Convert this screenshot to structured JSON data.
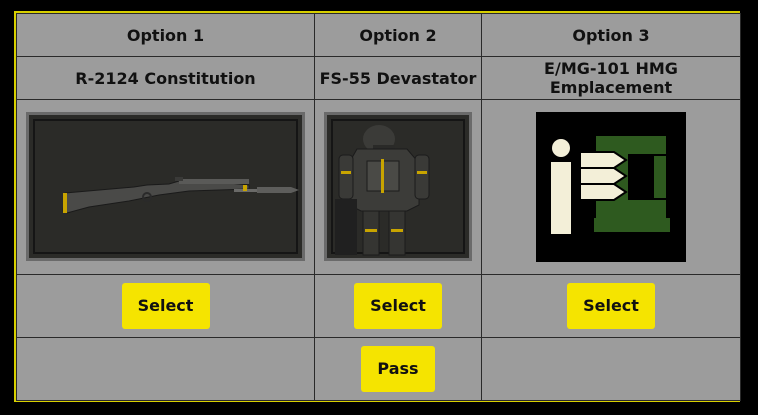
{
  "header": {
    "col1": "Option 1",
    "col2": "Option 2",
    "col3": "Option 3"
  },
  "options": [
    {
      "name": "R-2124 Constitution",
      "icon": "rifle-image",
      "select_label": "Select"
    },
    {
      "name": "FS-55 Devastator",
      "icon": "armor-image",
      "select_label": "Select"
    },
    {
      "name": "E/MG-101 HMG Emplacement",
      "icon": "hmg-emplacement-icon",
      "select_label": "Select"
    }
  ],
  "pass_label": "Pass",
  "colors": {
    "accent": "#f5e400",
    "frame": "#d8d000",
    "cell_bg": "#9c9c9c",
    "hmg_green": "#2e5a1f",
    "hmg_white": "#f3efd8"
  }
}
